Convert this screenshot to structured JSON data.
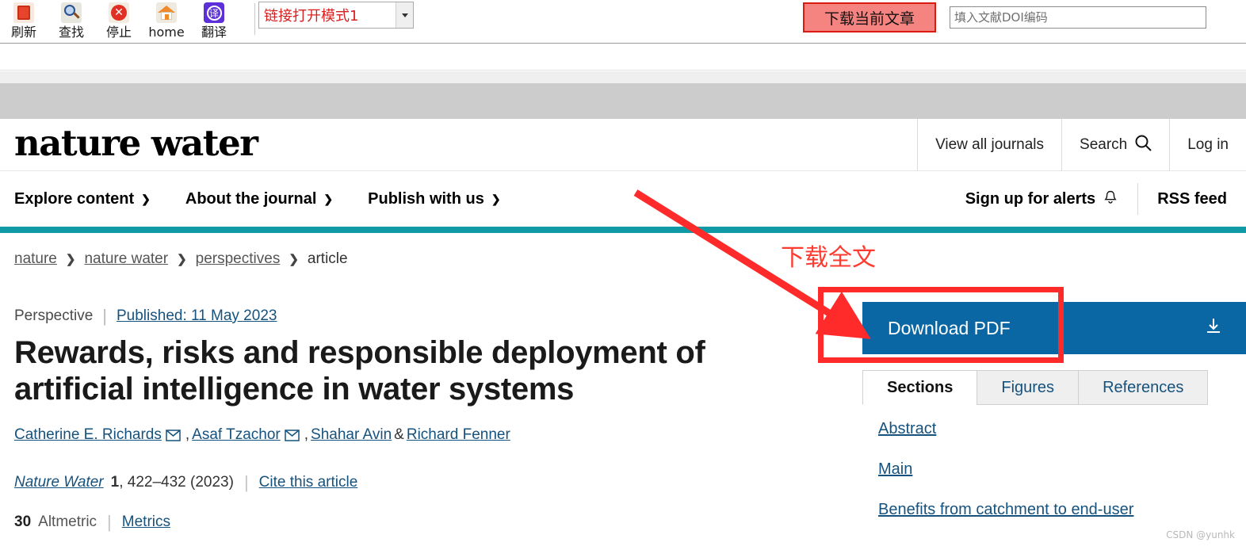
{
  "toolbar": {
    "items": [
      {
        "label": "刷新",
        "icon": "refresh-icon"
      },
      {
        "label": "查找",
        "icon": "find-icon"
      },
      {
        "label": "停止",
        "icon": "stop-icon"
      },
      {
        "label": "home",
        "icon": "home-icon"
      },
      {
        "label": "翻译",
        "icon": "translate-icon"
      }
    ],
    "link_mode_select": {
      "value": "链接打开模式1",
      "icon": "chevron-down-icon"
    },
    "download_button": "下载当前文章",
    "doi_input": {
      "value": "",
      "placeholder": "填入文献DOI编码"
    }
  },
  "masthead": {
    "logo": "nature water",
    "links": [
      "View all journals",
      "Search",
      "Log in"
    ],
    "search_icon": "search-icon"
  },
  "nav": {
    "left": [
      {
        "label": "Explore content",
        "caret": "⌄"
      },
      {
        "label": "About the journal",
        "caret": "⌄"
      },
      {
        "label": "Publish with us",
        "caret": "⌄"
      }
    ],
    "right": [
      {
        "label": "Sign up for alerts",
        "icon": "bell-icon"
      },
      {
        "label": "RSS feed",
        "icon": ""
      }
    ],
    "accent_color": "#0f9aa5"
  },
  "breadcrumb": {
    "items": [
      "nature",
      "nature water",
      "perspectives",
      "article"
    ],
    "separator": "❯"
  },
  "article": {
    "type": "Perspective",
    "published": "Published: 11 May 2023",
    "title": "Rewards, risks and responsible deployment of artificial intelligence in water systems",
    "authors": [
      {
        "name": "Catherine E. Richards",
        "envelope": true
      },
      {
        "name": "Asaf Tzachor",
        "envelope": true
      },
      {
        "name": "Shahar Avin",
        "envelope": false
      },
      {
        "name": "Richard Fenner",
        "envelope": false
      }
    ],
    "author_separators": [
      ", ",
      ", ",
      " & "
    ],
    "journal": "Nature Water",
    "volume": "1",
    "pages_year": ", 422–432 (2023)",
    "cite_link": "Cite this article",
    "altmetric_count": "30",
    "altmetric_label": "Altmetric",
    "metrics_link": "Metrics",
    "envelope_icon": "envelope-icon"
  },
  "rail": {
    "download_pdf": "Download PDF",
    "download_icon": "download-icon",
    "download_color": "#0a67a3",
    "tabs": [
      {
        "label": "Sections",
        "active": true
      },
      {
        "label": "Figures",
        "active": false
      },
      {
        "label": "References",
        "active": false
      }
    ],
    "toc": [
      "Abstract",
      "Main",
      "Benefits from catchment to end-user"
    ]
  },
  "annotations": {
    "text": "下载全文",
    "color": "#ff3b30",
    "arrow_icon": "arrow-icon",
    "highlight_box": "download-pdf-highlight"
  },
  "watermark": "CSDN @yunhk"
}
